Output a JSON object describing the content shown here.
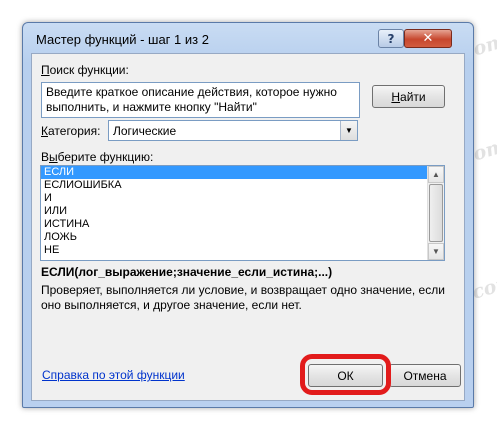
{
  "window": {
    "title": "Мастер функций - шаг 1 из 2"
  },
  "titlebar": {
    "help_glyph": "?",
    "close_glyph": "✕"
  },
  "search": {
    "label_hotkey": "П",
    "label_rest": "оиск функции:",
    "description": "Введите краткое описание действия, которое нужно выполнить, и нажмите кнопку \"Найти\"",
    "find_hotkey": "Н",
    "find_rest": "айти"
  },
  "category": {
    "label_hotkey": "К",
    "label_rest": "атегория:",
    "selected": "Логические"
  },
  "functions": {
    "label_prefix": "В",
    "label_hotkey": "ы",
    "label_rest": "берите функцию:",
    "items": [
      "ЕСЛИ",
      "ЕСЛИОШИБКА",
      "И",
      "ИЛИ",
      "ИСТИНА",
      "ЛОЖЬ",
      "НЕ"
    ],
    "selected_index": 0
  },
  "details": {
    "syntax": "ЕСЛИ(лог_выражение;значение_если_истина;...)",
    "description": "Проверяет, выполняется ли условие, и возвращает одно значение, если оно выполняется, и другое значение, если нет."
  },
  "footer": {
    "help_link": "Справка по этой функции",
    "ok_label": "ОК",
    "cancel_label": "Отмена"
  },
  "watermark": "Soringpcrepair.com",
  "colors": {
    "selection": "#3399ff",
    "highlight_ring": "#e21b1b",
    "link": "#0033cc"
  }
}
